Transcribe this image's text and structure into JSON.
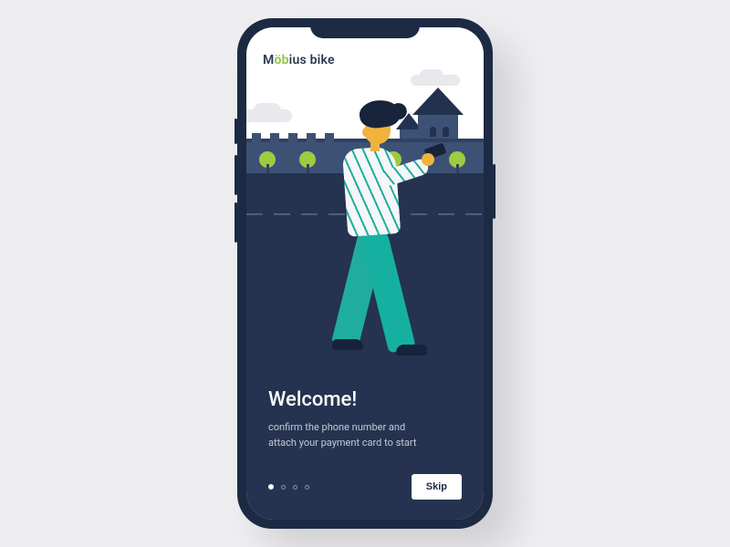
{
  "brand": {
    "pre": "M",
    "accent": "öb",
    "post": "ius bike"
  },
  "onboarding": {
    "title": "Welcome!",
    "subtitle": "confirm the phone number and attach your payment card to start",
    "skip_label": "Skip",
    "page_count": 4,
    "active_page": 0
  },
  "colors": {
    "device": "#1c2a44",
    "road": "#253350",
    "accent_green": "#8fc33e",
    "teal": "#1fae9d",
    "skin": "#f0b33c"
  }
}
